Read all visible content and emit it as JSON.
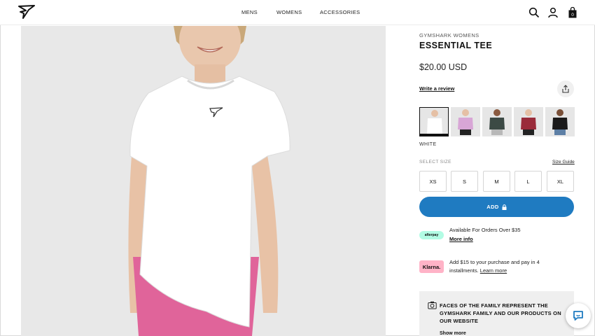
{
  "header": {
    "nav": [
      "MENS",
      "WOMENS",
      "ACCESSORIES"
    ]
  },
  "product": {
    "brand": "GYMSHARK WOMENS",
    "title": "ESSENTIAL TEE",
    "price": "$20.00 USD",
    "review_link": "Write a review",
    "color_name": "WHITE",
    "swatch_colors": [
      "#ffffff",
      "#d8a6d6",
      "#3c4a45",
      "#9a2b3a",
      "#1a1a1a"
    ],
    "select_size_label": "SELECT SIZE",
    "size_guide_label": "Size Guide",
    "sizes": [
      "XS",
      "S",
      "M",
      "L",
      "XL"
    ],
    "add_label": "ADD"
  },
  "payments": {
    "afterpay_badge": "afterpay",
    "afterpay_text": "Available For Orders Over $35",
    "afterpay_more": "More info",
    "klarna_badge": "Klarna.",
    "klarna_text": "Add $15 to your purchase and pay in 4 installments.",
    "klarna_learn": "Learn more"
  },
  "faces": {
    "text": "FACES OF THE FAMILY REPRESENT THE GYMSHARK FAMILY AND OUR PRODUCTS ON OUR WEBSITE",
    "more": "Show more"
  },
  "colors": {
    "accent": "#1f7bc1",
    "afterpay": "#b2fce4",
    "klarna": "#ffb3c7",
    "shorts": "#e0649a"
  }
}
